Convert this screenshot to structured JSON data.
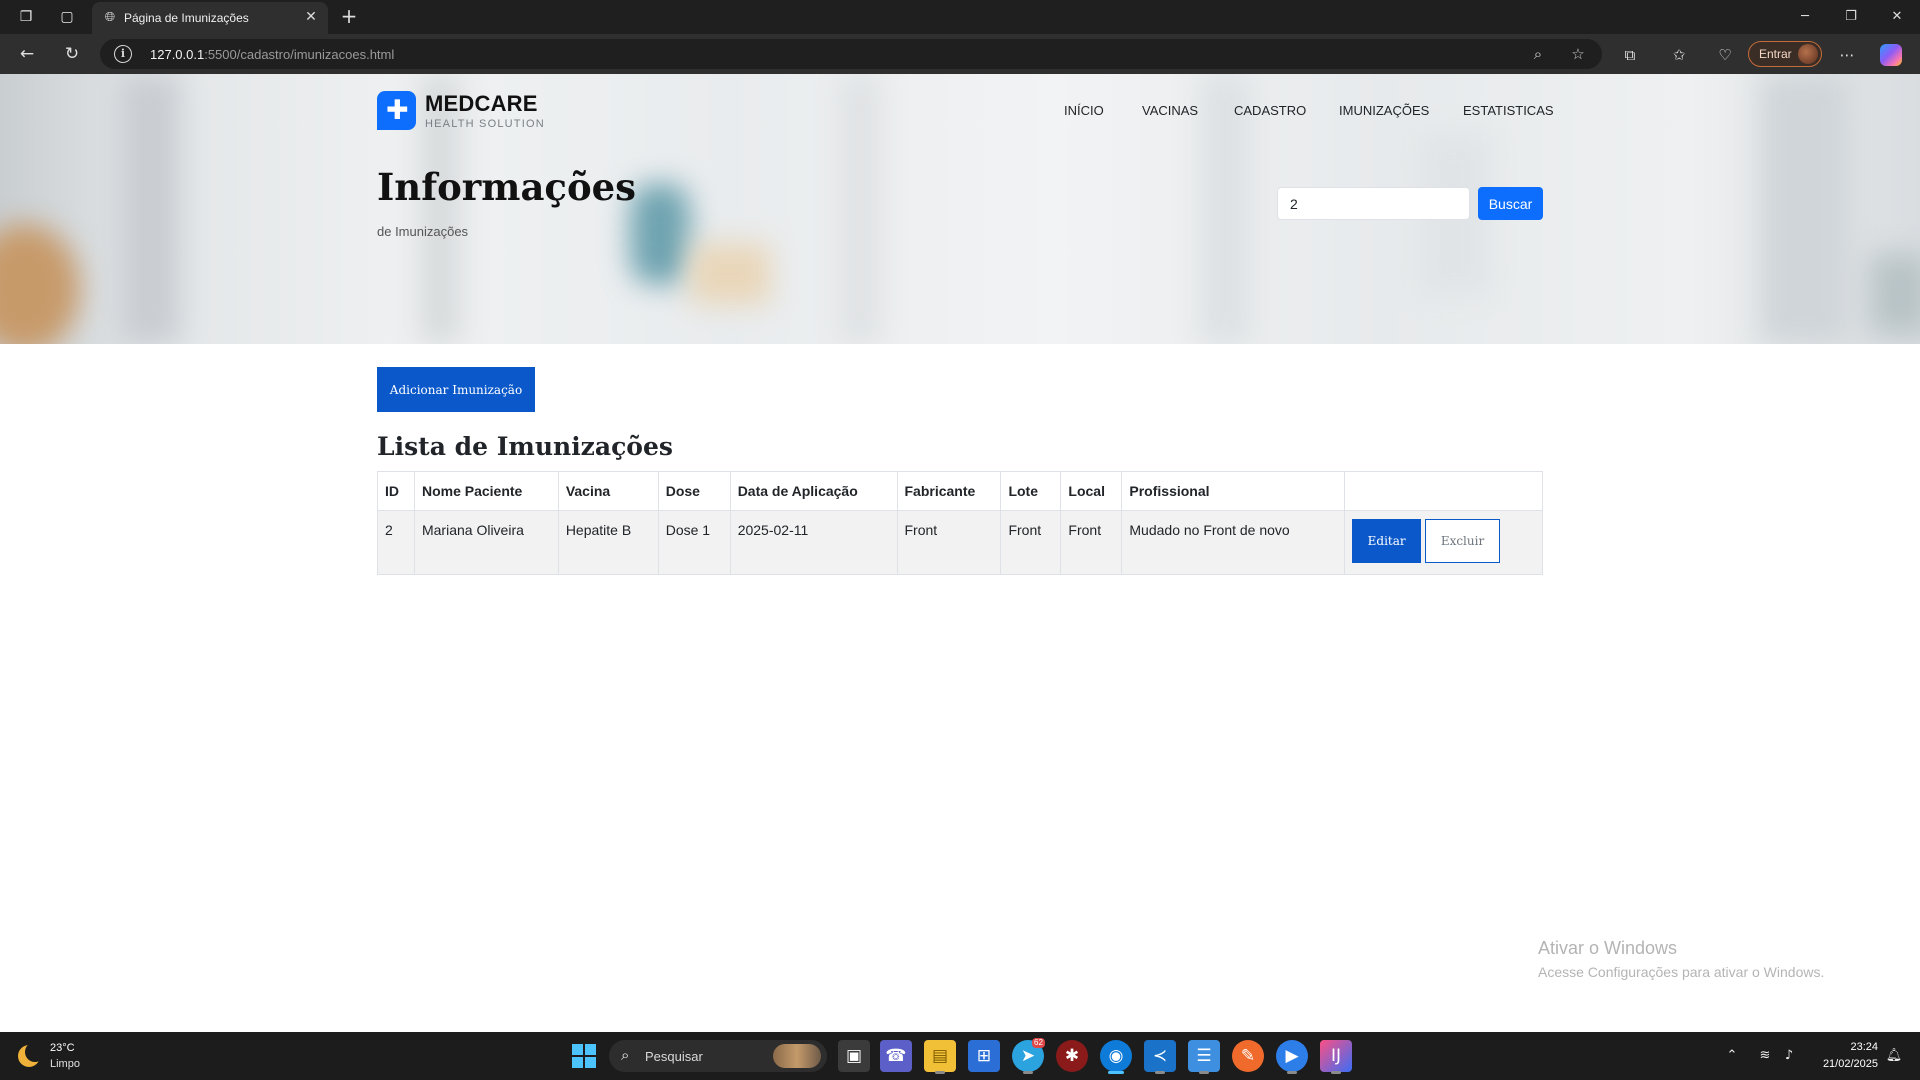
{
  "browser": {
    "tab_title": "Página de Imunizações",
    "url_host": "127.0.0.1",
    "url_rest": ":5500/cadastro/imunizacoes.html",
    "profile_label": "Entrar"
  },
  "site": {
    "logo_name": "MEDCARE",
    "logo_tagline": "HEALTH SOLUTION",
    "nav": [
      "INÍCIO",
      "VACINAS",
      "CADASTRO",
      "IMUNIZAÇÕES",
      "ESTATISTICAS"
    ]
  },
  "hero": {
    "title": "Informações",
    "subtitle": "de Imunizações",
    "search_value": "2",
    "search_button": "Buscar"
  },
  "main": {
    "add_button": "Adicionar Imunização",
    "list_title": "Lista de Imunizações",
    "table": {
      "headers": [
        "ID",
        "Nome Paciente",
        "Vacina",
        "Dose",
        "Data de Aplicação",
        "Fabricante",
        "Lote",
        "Local",
        "Profissional",
        ""
      ],
      "rows": [
        {
          "cells": [
            "2",
            "Mariana Oliveira",
            "Hepatite B",
            "Dose 1",
            "2025-02-11",
            "Front",
            "Front",
            "Front",
            "Mudado no Front de novo"
          ],
          "edit_label": "Editar",
          "delete_label": "Excluir"
        }
      ]
    }
  },
  "watermark": {
    "title": "Ativar o Windows",
    "subtitle": "Acesse Configurações para ativar o Windows."
  },
  "taskbar": {
    "weather_temp": "23°C",
    "weather_condition": "Limpo",
    "search_label": "Pesquisar",
    "telegram_badge": "62",
    "time": "23:24",
    "date": "21/02/2025"
  },
  "colors": {
    "primary": "#0d6efd",
    "primary_dark": "#0a58ca",
    "chrome_dark": "#1f1f1f",
    "table_row_bg": "#f2f2f2"
  }
}
